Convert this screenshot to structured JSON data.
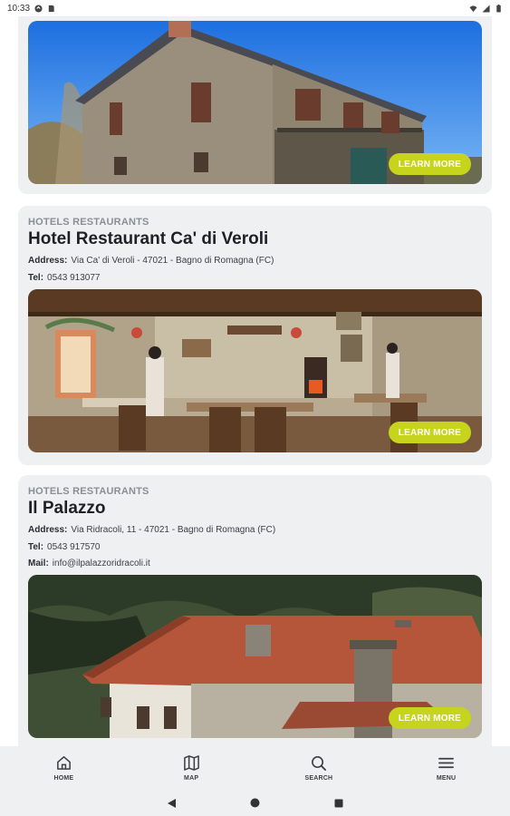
{
  "status_bar": {
    "time": "10:33"
  },
  "cards": [
    {},
    {
      "category": "HOTELS RESTAURANTS",
      "name": "Hotel Restaurant Ca' di Veroli",
      "address_label": "Address:",
      "address": "Via Ca' di Veroli - 47021 - Bagno di Romagna (FC)",
      "tel_label": "Tel:",
      "tel": "0543 913077"
    },
    {
      "category": "HOTELS RESTAURANTS",
      "name": "Il Palazzo",
      "address_label": "Address:",
      "address": "Via Ridracoli, 11 - 47021 - Bagno di Romagna (FC)",
      "tel_label": "Tel:",
      "tel": "0543 917570",
      "mail_label": "Mail:",
      "mail": "info@ilpalazzoridracoli.it"
    }
  ],
  "learn_more_label": "LEARN MORE",
  "bottom_nav": {
    "items": [
      {
        "label": "HOME",
        "icon": "home-icon"
      },
      {
        "label": "MAP",
        "icon": "map-icon"
      },
      {
        "label": "SEARCH",
        "icon": "search-icon"
      },
      {
        "label": "MENU",
        "icon": "menu-icon"
      }
    ]
  },
  "colors": {
    "accent": "#c7d41d",
    "card_bg": "#eef0f2",
    "text_dark": "#1d2125",
    "text_muted": "#8a8f94"
  }
}
